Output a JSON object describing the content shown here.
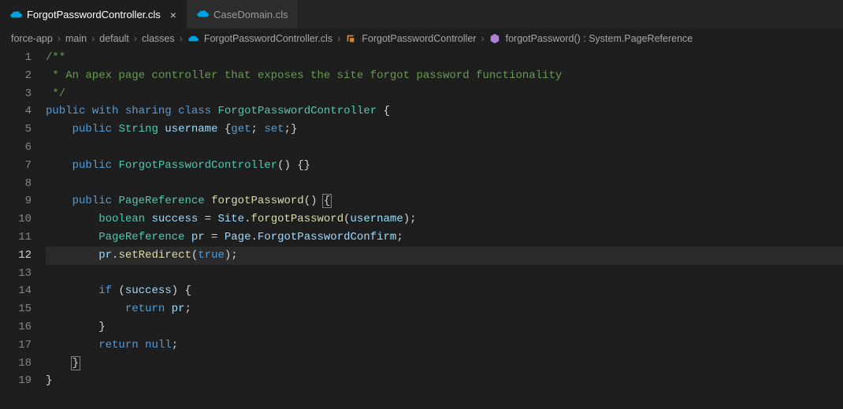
{
  "tabs": [
    {
      "label": "ForgotPasswordController.cls",
      "active": true
    },
    {
      "label": "CaseDomain.cls",
      "active": false
    }
  ],
  "breadcrumb": {
    "parts": [
      "force-app",
      "main",
      "default",
      "classes"
    ],
    "file": "ForgotPasswordController.cls",
    "class": "ForgotPasswordController",
    "method": "forgotPassword() : System.PageReference"
  },
  "editor": {
    "current_line": 12,
    "lines": {
      "l1": "/**",
      "l2": " * An apex page controller that exposes the site forgot password functionality",
      "l3": " */",
      "l4_kw1": "public",
      "l4_kw2": "with sharing",
      "l4_kw3": "class",
      "l4_type": "ForgotPasswordController",
      "l4_brace": " {",
      "l5_kw": "public",
      "l5_type": "String",
      "l5_var": "username",
      "l5_rest": " {",
      "l5_get": "get",
      "l5_set": "set",
      "l5_semi1": ";",
      "l5_semi2": ";",
      "l5_close": "}",
      "l7_kw": "public",
      "l7_type": "ForgotPasswordController",
      "l7_rest": "() {}",
      "l9_kw": "public",
      "l9_type": "PageReference",
      "l9_func": "forgotPassword",
      "l9_rest": "() ",
      "l9_brace": "{",
      "l10_type": "boolean",
      "l10_var": "success",
      "l10_eq": " = ",
      "l10_obj": "Site",
      "l10_dot": ".",
      "l10_func": "forgotPassword",
      "l10_open": "(",
      "l10_arg": "username",
      "l10_close": ");",
      "l11_type": "PageReference",
      "l11_var": "pr",
      "l11_eq": " = ",
      "l11_obj": "Page",
      "l11_dot": ".",
      "l11_prop": "ForgotPasswordConfirm",
      "l11_semi": ";",
      "l12_obj": "pr",
      "l12_dot": ".",
      "l12_func": "setRedirect",
      "l12_open": "(",
      "l12_arg": "true",
      "l12_close": ");",
      "l14_kw": "if",
      "l14_open": " (",
      "l14_var": "success",
      "l14_close": ") {",
      "l15_kw": "return",
      "l15_var": " pr",
      "l15_semi": ";",
      "l16_brace": "}",
      "l17_kw": "return",
      "l17_null": " null",
      "l17_semi": ";",
      "l18_brace": "}",
      "l19_brace": "}"
    }
  }
}
